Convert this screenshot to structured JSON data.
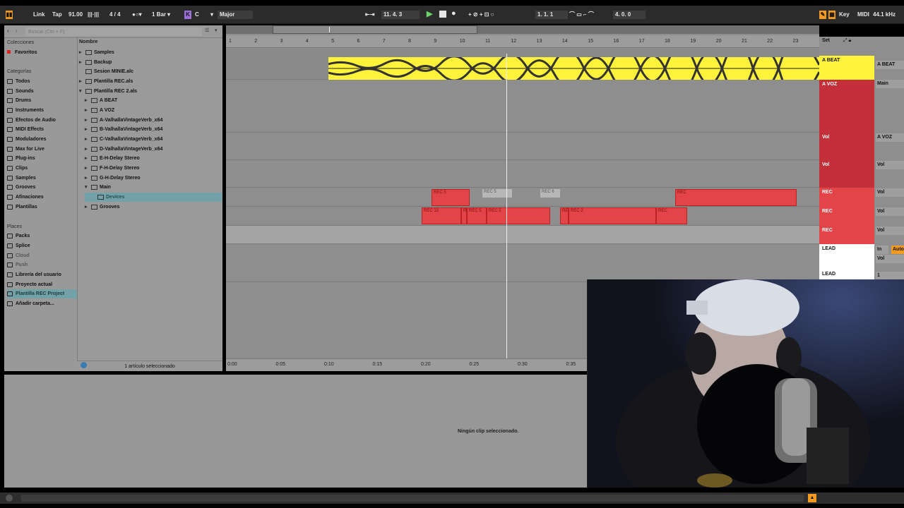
{
  "topbar": {
    "link": "Link",
    "tap": "Tap",
    "tempo": "91.00",
    "meter": "4 / 4",
    "quant": "1 Bar",
    "scale_key_badge": "K",
    "scale_root": "C",
    "scale_mode": "Major",
    "position": "11.   4.   3",
    "loop_start": "1.   1.   1",
    "loop_length": "4.   0.   0",
    "key_label": "Key",
    "midi_label": "MIDI",
    "sample_rate": "44.1 kHz"
  },
  "browser": {
    "search_placeholder": "Buscar (Ctrl + F)",
    "headers": {
      "collections": "Colecciones",
      "categories": "Categorías",
      "places": "Places",
      "name": "Nombre"
    },
    "collections": [
      "Favoritos"
    ],
    "categories": [
      "Todos",
      "Sounds",
      "Drums",
      "Instruments",
      "Efectos de Audio",
      "MIDI Effects",
      "Moduladores",
      "Max for Live",
      "Plug-ins",
      "Clips",
      "Samples",
      "Grooves",
      "Afinaciones",
      "Plantillas"
    ],
    "places": [
      "Packs",
      "Splice",
      "Cloud",
      "Push",
      "Librería del usuario",
      "Proyecto actual",
      "Plantilla REC Project",
      "Añadir carpeta..."
    ],
    "files": [
      "Samples",
      "Backup",
      "Sesion MINIE.alc",
      "Plantilla REC.als",
      "Plantilla REC 2.als",
      "A BEAT",
      "A VOZ",
      "A-ValhallaVintageVerb_x64",
      "B-ValhallaVintageVerb_x64",
      "C-ValhallaVintageVerb_x64",
      "D-ValhallaVintageVerb_x64",
      "E-H-Delay Stereo",
      "F-H-Delay Stereo",
      "G-H-Delay Stereo",
      "Main",
      "Devices",
      "Grooves"
    ],
    "footer": "1 artículo seleccionado"
  },
  "arrangement": {
    "bars": [
      "1",
      "2",
      "3",
      "4",
      "5",
      "6",
      "7",
      "8",
      "9",
      "10",
      "11",
      "12",
      "13",
      "14",
      "15",
      "16",
      "17",
      "18",
      "19",
      "20",
      "21",
      "22",
      "23"
    ],
    "times": [
      "0:00",
      "0:05",
      "0:10",
      "0:15",
      "0:20",
      "0:25",
      "0:30",
      "0:35"
    ],
    "clips": [
      "REC 5",
      "REC 5",
      "REC 6",
      "REC",
      "REC 13",
      "RE",
      "REC 5",
      "REC 5",
      "RE",
      "REC 2",
      "REC"
    ]
  },
  "mixer": {
    "set": "Set",
    "tracks": [
      "A BEAT",
      "A VOZ",
      "Vol",
      "Vol",
      "REC",
      "REC",
      "REC",
      "LEAD",
      "LEAD"
    ],
    "io": [
      "A BEAT",
      "Main",
      "A VOZ",
      "Vol",
      "Vol",
      "Vol",
      "Vol",
      "In",
      "Auto",
      "Vol",
      "1"
    ]
  },
  "detail": {
    "message": "Ningún clip seleccionado."
  },
  "colors": {
    "accent": "#f29b20",
    "clip_red": "#e24448",
    "audio_yellow": "#fff23a",
    "track_red": "#c4303a"
  }
}
